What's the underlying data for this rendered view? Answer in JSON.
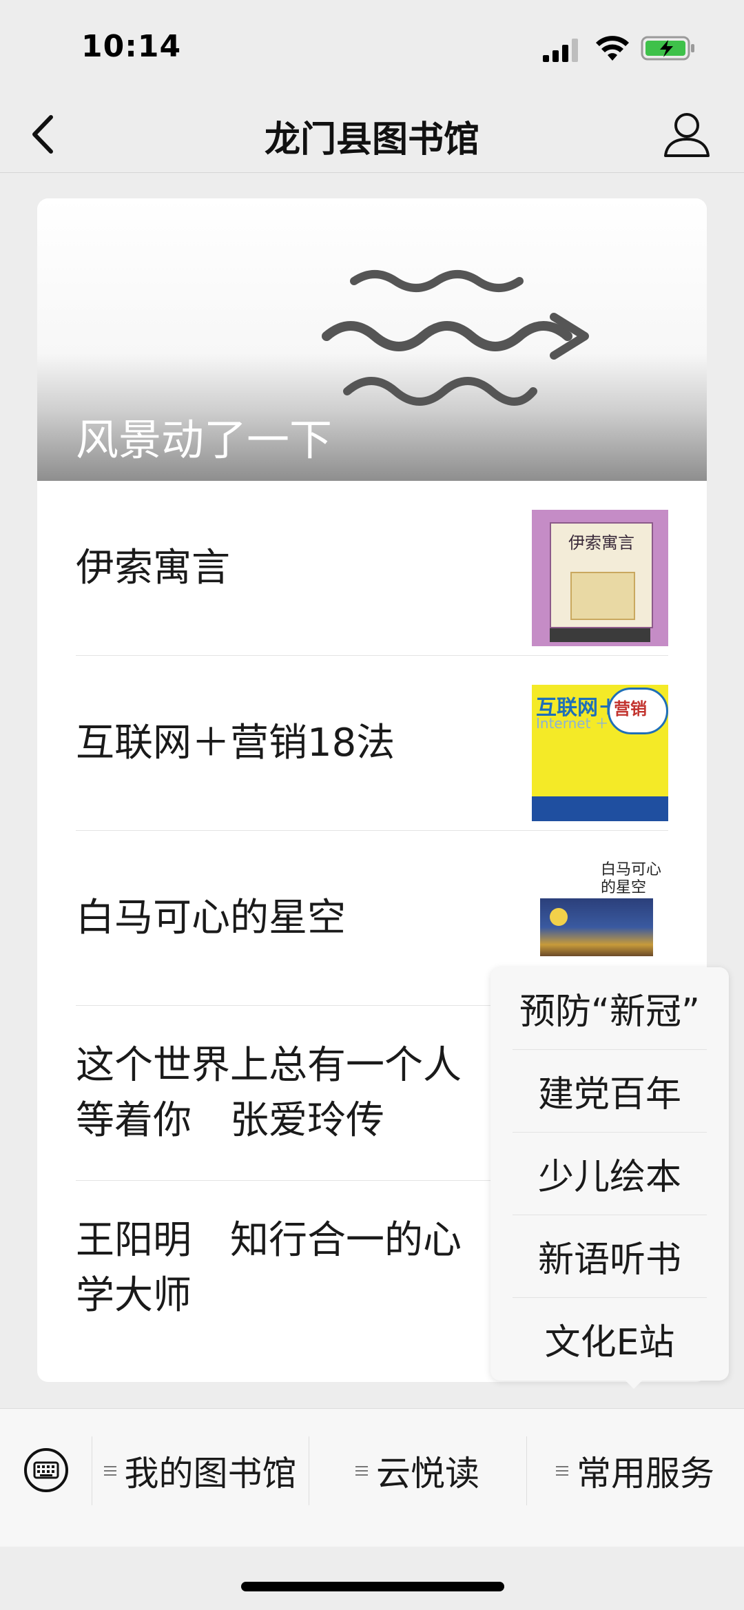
{
  "status_bar": {
    "time": "10:14"
  },
  "nav": {
    "title": "龙门县图书馆"
  },
  "cover": {
    "title": "风景动了一下"
  },
  "articles": [
    {
      "title": "伊索寓言",
      "thumb_title": "伊索寓言"
    },
    {
      "title": "互联网＋营销18法",
      "thumb_title": "互联网＋",
      "thumb_sub": "Internet ＋",
      "thumb_badge": "营销"
    },
    {
      "title": "白马可心的星空",
      "thumb_title": "白马可心的星空"
    },
    {
      "title": "这个世界上总有一个人等着你　张爱玲传"
    },
    {
      "title": "王阳明　知行合一的心学大师"
    }
  ],
  "popup_menu": {
    "items": [
      "预防“新冠”",
      "建党百年",
      "少儿绘本",
      "新语听书",
      "文化E站"
    ]
  },
  "bottom_menu": {
    "items": [
      "我的图书馆",
      "云悦读",
      "常用服务"
    ]
  },
  "icons": {
    "back": "chevron-left-icon",
    "profile": "user-icon",
    "keyboard": "keyboard-icon",
    "menu": "list-icon"
  }
}
